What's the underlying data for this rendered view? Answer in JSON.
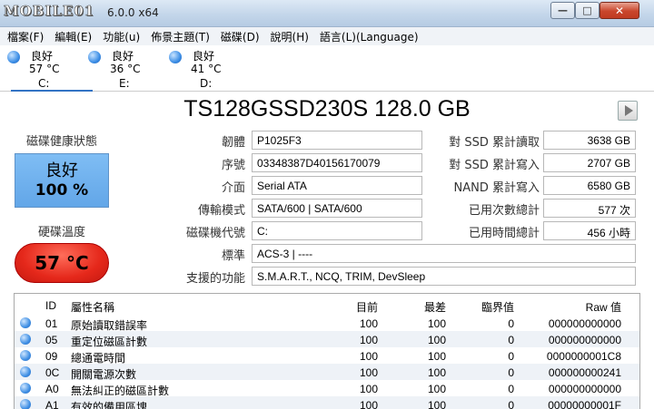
{
  "window": {
    "watermark": "MOBILE01",
    "title_suffix": "6.0.0 x64",
    "buttons": {
      "minimize": "—",
      "maximize": "□",
      "close": "✕"
    }
  },
  "menu": [
    {
      "label": "檔案(F)"
    },
    {
      "label": "編輯(E)"
    },
    {
      "label": "功能(u)"
    },
    {
      "label": "佈景主題(T)"
    },
    {
      "label": "磁碟(D)"
    },
    {
      "label": "說明(H)"
    },
    {
      "label": "語言(L)(Language)"
    }
  ],
  "disks": [
    {
      "status": "良好",
      "temp": "57 °C",
      "letter": "C:"
    },
    {
      "status": "良好",
      "temp": "36 °C",
      "letter": "E:"
    },
    {
      "status": "良好",
      "temp": "41 °C",
      "letter": "D:"
    }
  ],
  "drive": {
    "title": "TS128GSSD230S 128.0 GB"
  },
  "health": {
    "label": "磁碟健康狀態",
    "status": "良好",
    "percent": "100 %",
    "color": "#6eb0ee"
  },
  "temperature": {
    "label": "硬碟溫度",
    "value": "57 °C",
    "color": "#e5281b"
  },
  "info": {
    "firmware": {
      "label": "韌體",
      "value": "P1025F3"
    },
    "serial": {
      "label": "序號",
      "value": "03348387D40156170079"
    },
    "interface": {
      "label": "介面",
      "value": "Serial ATA"
    },
    "transfer": {
      "label": "傳輸模式",
      "value": "SATA/600 | SATA/600"
    },
    "drive_letter": {
      "label": "磁碟機代號",
      "value": "C:"
    },
    "standard": {
      "label": "標準",
      "value": "ACS-3 | ----"
    },
    "features": {
      "label": "支援的功能",
      "value": "S.M.A.R.T., NCQ, TRIM, DevSleep"
    }
  },
  "stats": {
    "host_reads": {
      "label": "對 SSD 累計讀取",
      "value": "3638 GB"
    },
    "host_writes": {
      "label": "對 SSD 累計寫入",
      "value": "2707 GB"
    },
    "nand_writes": {
      "label": "NAND 累計寫入",
      "value": "6580 GB"
    },
    "power_on_count": {
      "label": "已用次數總計",
      "value": "577 次"
    },
    "power_on_hours": {
      "label": "已用時間總計",
      "value": "456 小時"
    }
  },
  "smart_table": {
    "headers": {
      "id": "ID",
      "name": "屬性名稱",
      "current": "目前",
      "worst": "最差",
      "threshold": "臨界值",
      "raw": "Raw 值"
    },
    "rows": [
      {
        "id": "01",
        "name": "原始讀取錯誤率",
        "current": "100",
        "worst": "100",
        "threshold": "0",
        "raw": "000000000000"
      },
      {
        "id": "05",
        "name": "重定位磁區計數",
        "current": "100",
        "worst": "100",
        "threshold": "0",
        "raw": "000000000000"
      },
      {
        "id": "09",
        "name": "總通電時間",
        "current": "100",
        "worst": "100",
        "threshold": "0",
        "raw": "0000000001C8"
      },
      {
        "id": "0C",
        "name": "開關電源次數",
        "current": "100",
        "worst": "100",
        "threshold": "0",
        "raw": "000000000241"
      },
      {
        "id": "A0",
        "name": "無法糾正的磁區計數",
        "current": "100",
        "worst": "100",
        "threshold": "0",
        "raw": "000000000000"
      },
      {
        "id": "A1",
        "name": "有效的備用區塊",
        "current": "100",
        "worst": "100",
        "threshold": "0",
        "raw": "00000000001F"
      }
    ]
  }
}
